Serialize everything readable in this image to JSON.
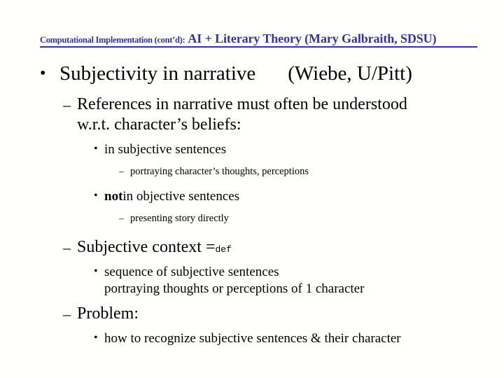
{
  "slide": {
    "title": {
      "prefix": "Computational Implementation (cont’d):",
      "main": "AI + Literary Theory (Mary Galbraith, SDSU)",
      "color": "#333399"
    },
    "body": {
      "l1_subjectivity": "Subjectivity in narrative",
      "l1_attribution": "(Wiebe, U/Pitt)",
      "l2_references_line1": "References in narrative must often be understood",
      "l2_references_line2": "w.r.t. character’s beliefs:",
      "l3_in_subjective": "in subjective sentences",
      "l4_portraying": "portraying character’s thoughts, perceptions",
      "l3_not_word": "not",
      "l3_not_rest": " in objective sentences",
      "l4_presenting": "presenting story directly",
      "l2_subjective_context": "Subjective context =",
      "l2_subjective_context_sub": "def",
      "l3_sequence_line1": "sequence of subjective sentences",
      "l3_sequence_line2": "portraying thoughts or perceptions of 1 character",
      "l2_problem": "Problem:",
      "l3_how_to": "how to recognize subjective sentences & their character"
    },
    "markers": {
      "bullet_round": "•",
      "dash": "–"
    }
  }
}
